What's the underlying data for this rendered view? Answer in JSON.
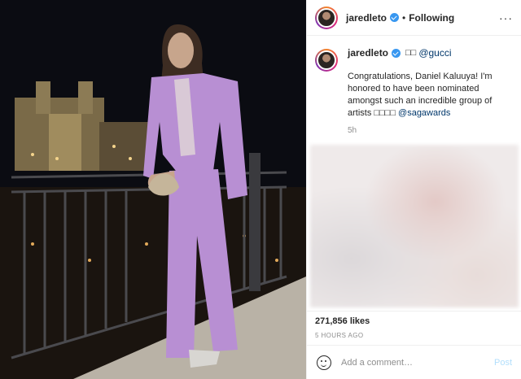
{
  "header": {
    "username": "jaredleto",
    "separator": "•",
    "follow_status": "Following",
    "more": "···"
  },
  "caption": {
    "username": "jaredleto",
    "tag_glyphs": "□□",
    "mention": "@gucci",
    "text": "Congratulations, Daniel Kaluuya! I'm honored to have been nominated amongst such an incredible group of artists □□□□ ",
    "text_mention": "@sagawards",
    "time": "5h"
  },
  "stats": {
    "likes": "271,856 likes",
    "posted": "5 HOURS AGO"
  },
  "comment": {
    "placeholder": "Add a comment…",
    "post_label": "Post"
  },
  "colors": {
    "link": "#00376b",
    "verified": "#3897f0",
    "post_disabled": "#b2dffc",
    "suit": "#b88fd3"
  },
  "icons": {
    "verified": "verified-badge-icon",
    "more": "more-options-icon",
    "emoji": "emoji-icon"
  }
}
